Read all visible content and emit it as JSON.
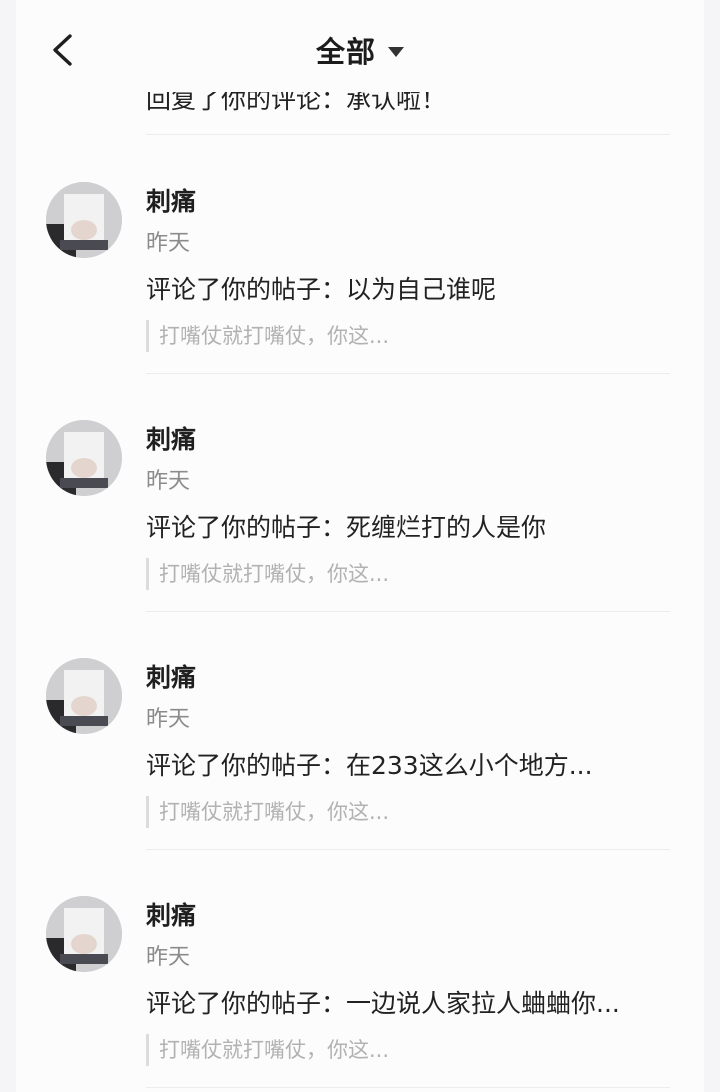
{
  "header": {
    "title": "全部",
    "back_icon": "chevron-left-icon",
    "dropdown_icon": "caret-down-icon"
  },
  "partial_item": {
    "comment": "回复了你的评论：承认啦！"
  },
  "notifications": [
    {
      "name": "刺痛",
      "time": "昨天",
      "comment": "评论了你的帖子：以为自己谁呢",
      "quote": "打嘴仗就打嘴仗，你这..."
    },
    {
      "name": "刺痛",
      "time": "昨天",
      "comment": "评论了你的帖子：死缠烂打的人是你",
      "quote": "打嘴仗就打嘴仗，你这..."
    },
    {
      "name": "刺痛",
      "time": "昨天",
      "comment": "评论了你的帖子：在233这么小个地方...",
      "quote": "打嘴仗就打嘴仗，你这..."
    },
    {
      "name": "刺痛",
      "time": "昨天",
      "comment": "评论了你的帖子：一边说人家拉人蛐蛐你...",
      "quote": "打嘴仗就打嘴仗，你这..."
    }
  ]
}
